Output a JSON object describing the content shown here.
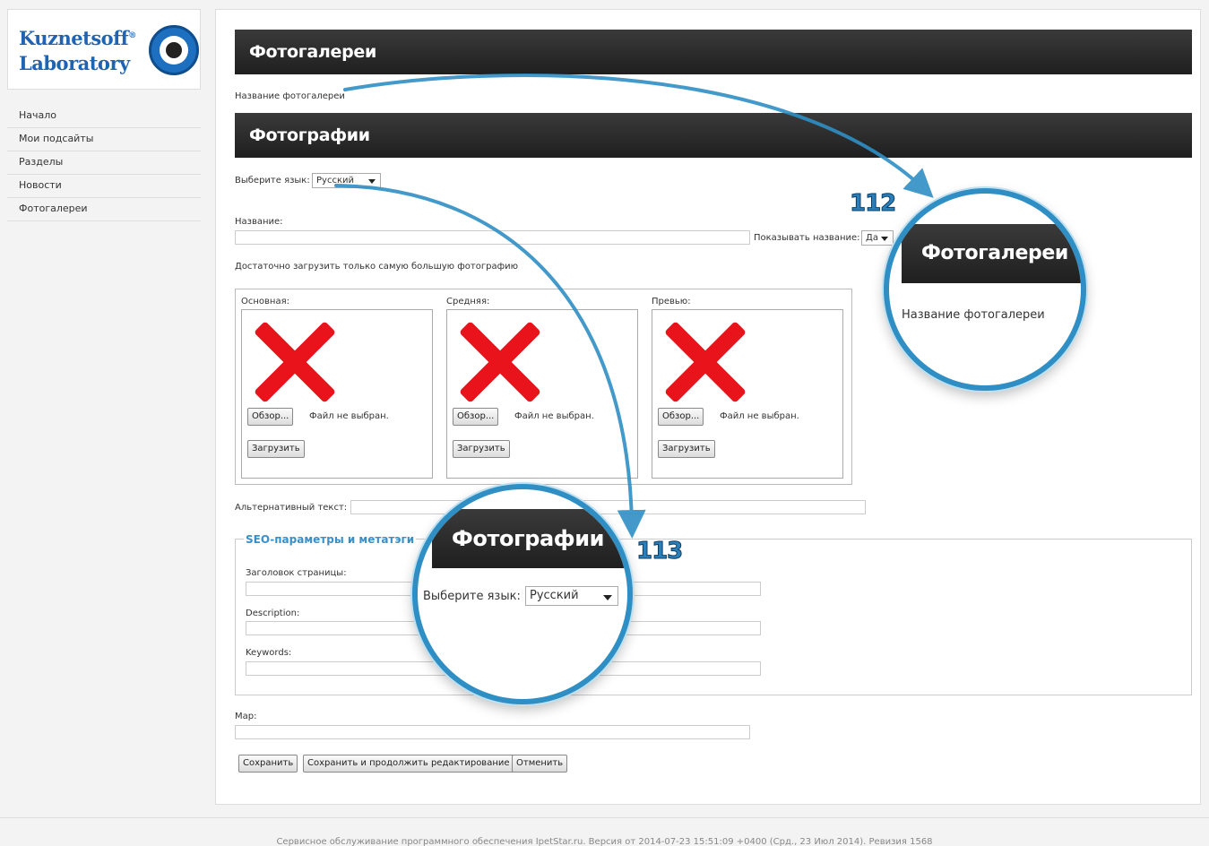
{
  "logo": {
    "line1": "Kuznetsoff",
    "line2": "Laboratory",
    "reg": "®"
  },
  "sidebar": {
    "items": [
      {
        "label": "Начало"
      },
      {
        "label": "Мои подсайты"
      },
      {
        "label": "Разделы"
      },
      {
        "label": "Новости"
      },
      {
        "label": "Фотогалереи"
      }
    ]
  },
  "header": {
    "title": "Фотогалереи",
    "subtitle": "Название фотогалереи"
  },
  "photos": {
    "title": "Фотографии",
    "language_label": "Выберите язык:",
    "language_value": "Русский",
    "name_label": "Название:",
    "show_name_label": "Показывать название:",
    "show_name_value": "Да",
    "hint": "Достаточно загрузить только самую большую фотографию",
    "columns": [
      {
        "title": "Основная:",
        "browse": "Обзор...",
        "nofile": "Файл не выбран.",
        "upload": "Загрузить"
      },
      {
        "title": "Средняя:",
        "browse": "Обзор...",
        "nofile": "Файл не выбран.",
        "upload": "Загрузить"
      },
      {
        "title": "Превью:",
        "browse": "Обзор...",
        "nofile": "Файл не выбран.",
        "upload": "Загрузить"
      }
    ],
    "alt_label": "Альтернативный текст:"
  },
  "seo": {
    "legend": "SEO-параметры и метатэги",
    "page_title_label": "Заголовок страницы:",
    "description_label": "Description:",
    "keywords_label": "Keywords:"
  },
  "map_label": "Map:",
  "actions": {
    "save": "Сохранить",
    "save_continue": "Сохранить и продолжить редактирование",
    "cancel": "Отменить"
  },
  "callout_112": {
    "number": "112",
    "title": "Фотогалереи",
    "text": "Название фотогалереи"
  },
  "callout_113": {
    "number": "113",
    "title": "Фотографии",
    "lang_label": "Выберите язык:",
    "lang_value": "Русский"
  },
  "footer": "Сервисное обслуживание программного обеспечения IpetStar.ru. Версия от 2014-07-23 15:51:09 +0400 (Срд., 23 Июл 2014). Ревизия 1568",
  "colors": {
    "accent": "#2f8fc4",
    "bar": "#2a2a2a",
    "error_x": "#e8131b",
    "seo_legend": "#3a8fc6"
  }
}
